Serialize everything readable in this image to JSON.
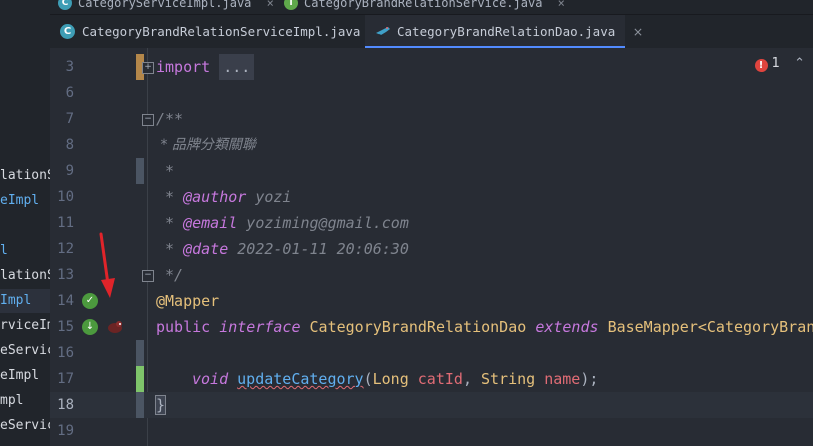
{
  "project_tree": [
    {
      "text": "lationS",
      "type": "plain"
    },
    {
      "text": "eImpl",
      "type": "class"
    },
    {
      "text": "l",
      "type": "class"
    },
    {
      "text": "lationS",
      "type": "plain"
    },
    {
      "text": "Impl",
      "type": "class"
    },
    {
      "text": "rviceIm",
      "type": "plain"
    },
    {
      "text": "eServic",
      "type": "plain"
    },
    {
      "text": "eImpl",
      "type": "plain"
    },
    {
      "text": "mpl",
      "type": "plain"
    },
    {
      "text": "eServic",
      "type": "plain"
    }
  ],
  "top_tabs": [
    {
      "label": "CategoryServiceImpl.java",
      "icon": "class-icon"
    },
    {
      "label": "CategoryBrandRelationService.java",
      "icon": "interface-icon"
    }
  ],
  "tabs": [
    {
      "label": "CategoryBrandRelationServiceImpl.java",
      "icon": "class-icon",
      "active": false
    },
    {
      "label": "CategoryBrandRelationDao.java",
      "icon": "mybatis-icon",
      "active": true
    }
  ],
  "editor": {
    "error_count": "1",
    "line_numbers": [
      "3",
      "6",
      "7",
      "8",
      "9",
      "10",
      "11",
      "12",
      "13",
      "14",
      "15",
      "16",
      "17",
      "18",
      "19"
    ],
    "lines": {
      "l3_import": "import",
      "l3_fold": "...",
      "l7": "/**",
      "l8": " * 品牌分類關聯",
      "l9": " *",
      "l10_star": " * ",
      "l10_tag": "@author",
      "l10_val": " yozi",
      "l11_star": " * ",
      "l11_tag": "@email",
      "l11_val": " yoziming@gmail.com",
      "l12_star": " * ",
      "l12_tag": "@date",
      "l12_val": " 2022-01-11 20:06:30",
      "l13": " */",
      "l14": "@Mapper",
      "l15_kw1": "public",
      "l15_kw2": "interface",
      "l15_name": "CategoryBrandRelationDao",
      "l15_kw3": "extends",
      "l15_base": "BaseMapper<CategoryBrand",
      "l17_kw": "void",
      "l17_fn": "updateCategory",
      "l17_open": "(",
      "l17_t1": "Long",
      "l17_p1": "catId",
      "l17_sep": ", ",
      "l17_t2": "String",
      "l17_p2": "name",
      "l17_close": ");",
      "l18": "}"
    }
  },
  "colors": {
    "accent": "#528bff",
    "error": "#e0443e",
    "arrow": "#e0242a"
  }
}
